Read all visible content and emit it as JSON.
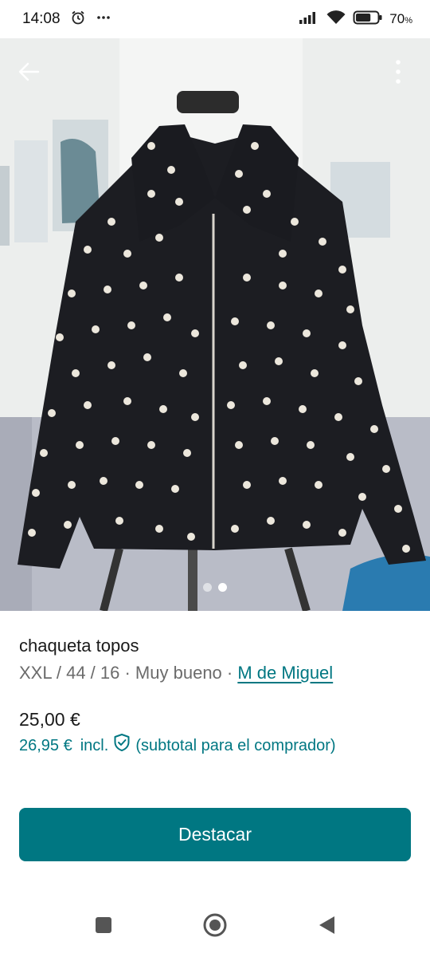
{
  "status_bar": {
    "time": "14:08",
    "battery_value": "70",
    "battery_unit": "%",
    "battery_level": 0.7,
    "icons": [
      "alarm-icon",
      "more-dots-icon",
      "signal-icon",
      "wifi-icon",
      "battery-icon"
    ]
  },
  "photo": {
    "page_count": 2,
    "active_page": 2,
    "icons": [
      "back-arrow-icon",
      "more-vert-icon"
    ]
  },
  "item": {
    "title": "chaqueta topos",
    "meta_prefix": "XXL / 44 / 16 · Muy bueno · ",
    "seller": "M de Miguel",
    "price": "25,00 €",
    "price_incl_amount": "26,95 €",
    "price_incl_label": "incl.",
    "price_incl_note": "(subtotal para el comprador)"
  },
  "actions": {
    "primary_label": "Destacar"
  },
  "colors": {
    "accent": "#007782",
    "button_text": "#ffffff",
    "muted_text": "#6b6b6b"
  },
  "nav_bar": {
    "icons": [
      "recents-square-icon",
      "home-circle-icon",
      "back-triangle-icon"
    ]
  }
}
